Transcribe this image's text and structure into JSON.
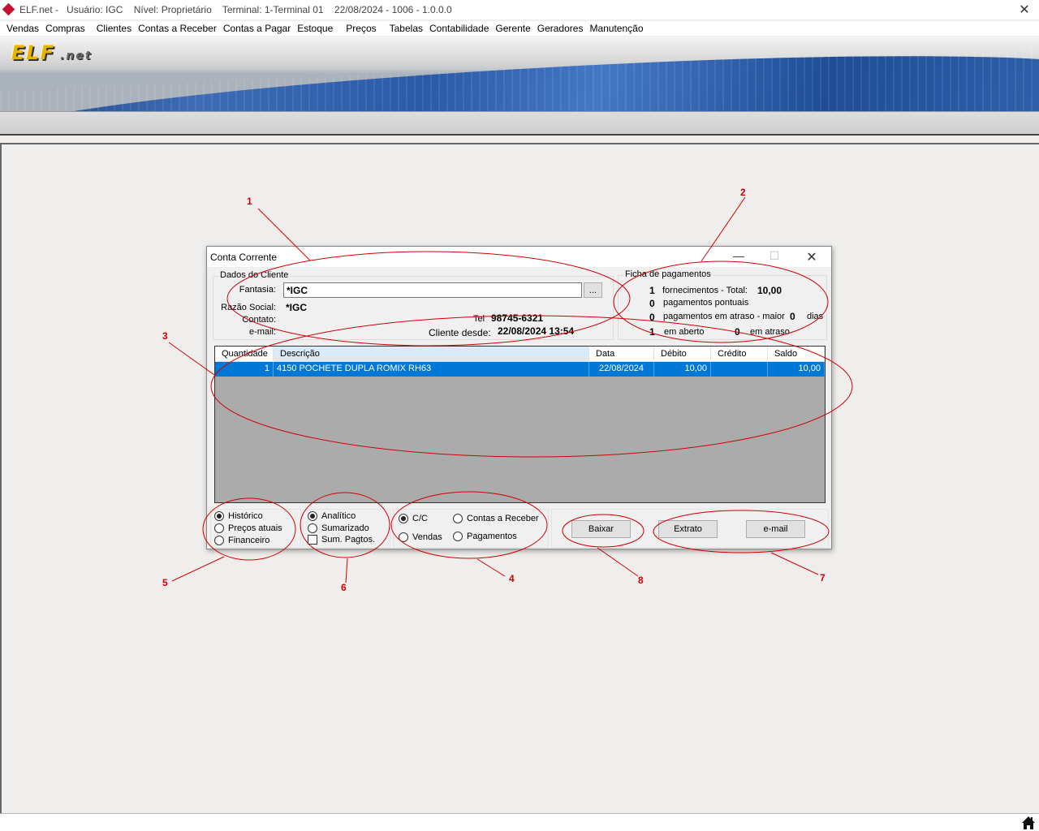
{
  "window": {
    "title": "ELF.net -   Usuário: IGC    Nível: Proprietário    Terminal: 1-Terminal 01    22/08/2024 - 1006 - 1.0.0.0",
    "close_glyph": "✕"
  },
  "menu": [
    "Vendas",
    "Compras",
    "Clientes",
    "Contas a Receber",
    "Contas a Pagar",
    "Estoque",
    "Preços",
    "Tabelas",
    "Contabilidade",
    "Gerente",
    "Geradores",
    "Manutenção"
  ],
  "banner": {
    "logo": "ELF",
    "logo_suffix": ".net"
  },
  "dialog": {
    "title": "Conta Corrente",
    "controls": {
      "minimize": "—",
      "maximize": "☐",
      "close": "✕"
    },
    "cliente": {
      "legend": "Dados do Cliente",
      "fantasia_label": "Fantasia:",
      "fantasia_value": "*IGC",
      "browse_label": "...",
      "razao_label": "Razão Social:",
      "razao_value": "*IGC",
      "contato_label": "Contato:",
      "email_label": "e-mail:",
      "tel_label": "Tel",
      "tel_value": "98745-6321",
      "desde_label": "Cliente desde:",
      "desde_value": "22/08/2024 13:54"
    },
    "ficha": {
      "legend": "Ficha de pagamentos",
      "fornecimentos_count": "1",
      "fornecimentos_label": "fornecimentos - Total:",
      "fornecimentos_total": "10,00",
      "pontuais_count": "0",
      "pontuais_label": "pagamentos pontuais",
      "atraso_count": "0",
      "atraso_label": "pagamentos em atraso - maior",
      "atraso_maior": "0",
      "dias_label": "dias",
      "aberto_count": "1",
      "aberto_label": "em aberto",
      "em_atraso_count": "0",
      "em_atraso_label": "em atraso"
    },
    "grid": {
      "columns": [
        "Quantidade",
        "Descrição",
        "Data",
        "Débito",
        "Crédito",
        "Saldo"
      ],
      "rows": [
        {
          "quantidade": "1",
          "descricao": "4150 POCHETE DUPLA ROMIX RH63",
          "data": "22/08/2024",
          "debito": "10,00",
          "credito": "",
          "saldo": "10,00"
        }
      ]
    },
    "options_hist": [
      {
        "label": "Histórico",
        "selected": true
      },
      {
        "label": "Preços atuais",
        "selected": false
      },
      {
        "label": "Financeiro",
        "selected": false
      }
    ],
    "options_mode": [
      {
        "label": "Analítico",
        "selected": true
      },
      {
        "label": "Sumarizado",
        "selected": false
      }
    ],
    "sum_pagtos": {
      "label": "Sum. Pagtos.",
      "checked": false
    },
    "options_type": [
      {
        "label": "C/C",
        "selected": true
      },
      {
        "label": "Contas a Receber",
        "selected": false
      },
      {
        "label": "Vendas",
        "selected": false
      },
      {
        "label": "Pagamentos",
        "selected": false
      }
    ],
    "buttons": {
      "baixar": "Baixar",
      "extrato": "Extrato",
      "email": "e-mail"
    }
  },
  "annotations": [
    "1",
    "2",
    "3",
    "4",
    "5",
    "6",
    "7",
    "8"
  ],
  "colors": {
    "annotation": "#d00000",
    "selection": "#0078d7",
    "grid_empty": "#ababab"
  }
}
